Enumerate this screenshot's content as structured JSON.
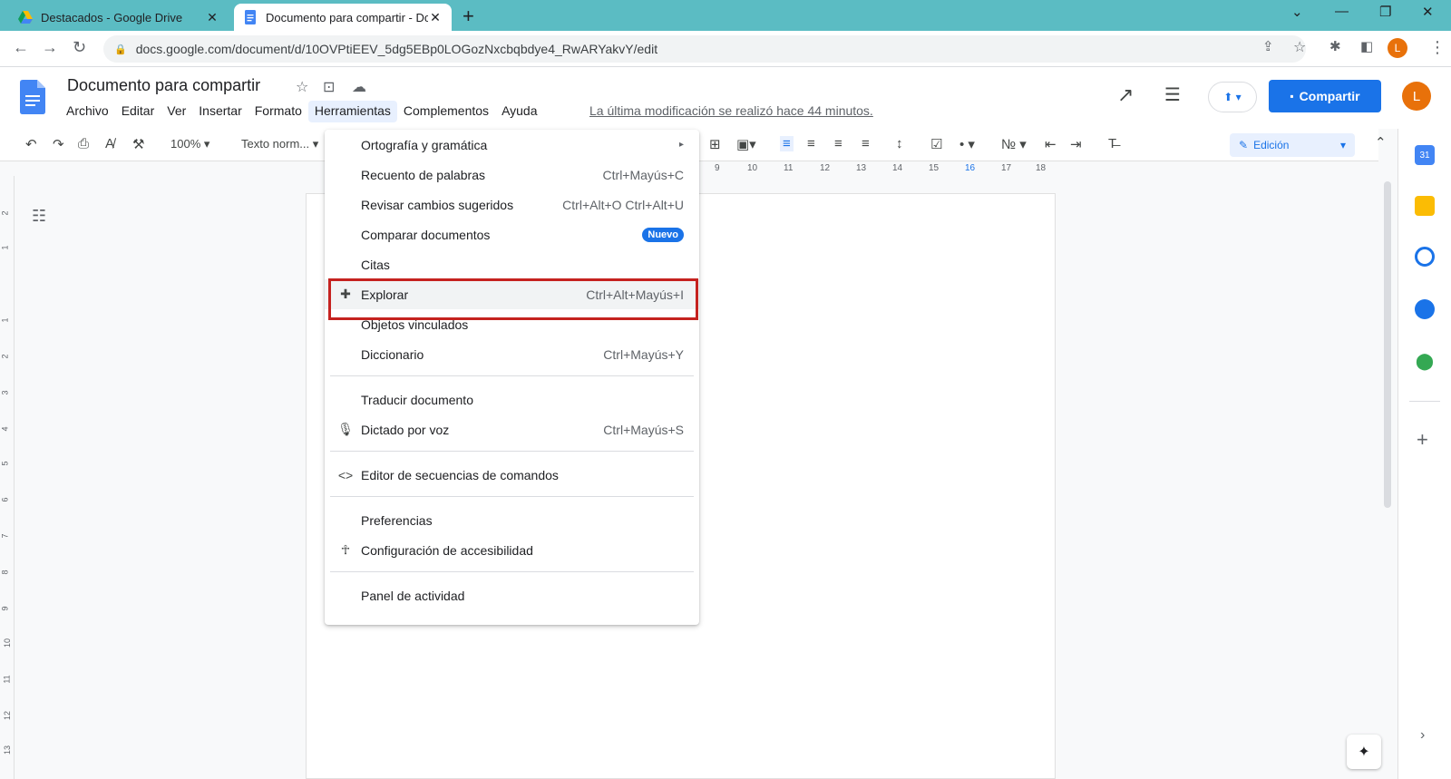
{
  "browser": {
    "tabs": [
      {
        "title": "Destacados - Google Drive"
      },
      {
        "title": "Documento para compartir - Doc"
      }
    ],
    "url": "docs.google.com/document/d/10OVPtiEEV_5dg5EBp0LOGozNxcbqbdye4_RwARYakvY/edit",
    "profile_initial": "L"
  },
  "doc": {
    "title": "Documento para compartir",
    "menus": [
      "Archivo",
      "Editar",
      "Ver",
      "Insertar",
      "Formato",
      "Herramientas",
      "Complementos",
      "Ayuda"
    ],
    "active_menu": "Herramientas",
    "last_edit": "La última modificación se realizó hace 44 minutos.",
    "share_label": "Compartir",
    "avatar_initial": "L"
  },
  "toolbar": {
    "zoom": "100%",
    "style": "Texto norm...",
    "mode": "Edición"
  },
  "ruler": {
    "ticks": [
      "9",
      "10",
      "11",
      "12",
      "13",
      "14",
      "15",
      "16",
      "17",
      "18"
    ]
  },
  "vruler": {
    "ticks": [
      "2",
      "1",
      "1",
      "2",
      "3",
      "4",
      "5",
      "6",
      "7",
      "8",
      "9",
      "10",
      "11",
      "12",
      "13"
    ]
  },
  "tools_menu": {
    "items": [
      {
        "label": "Ortografía y gramática",
        "shortcut": "▸",
        "icon": ""
      },
      {
        "label": "Recuento de palabras",
        "shortcut": "Ctrl+Mayús+C",
        "icon": ""
      },
      {
        "label": "Revisar cambios sugeridos",
        "shortcut": "Ctrl+Alt+O Ctrl+Alt+U",
        "icon": ""
      },
      {
        "label": "Comparar documentos",
        "badge": "Nuevo",
        "icon": ""
      },
      {
        "label": "Citas",
        "shortcut": "",
        "icon": ""
      },
      {
        "label": "Explorar",
        "shortcut": "Ctrl+Alt+Mayús+I",
        "icon": "explore-icon"
      },
      {
        "label": "Objetos vinculados",
        "shortcut": "",
        "icon": ""
      },
      {
        "label": "Diccionario",
        "shortcut": "Ctrl+Mayús+Y",
        "icon": ""
      },
      {
        "label": "Traducir documento",
        "shortcut": "",
        "icon": ""
      },
      {
        "label": "Dictado por voz",
        "shortcut": "Ctrl+Mayús+S",
        "icon": "mic-icon"
      },
      {
        "label": "Editor de secuencias de comandos",
        "shortcut": "",
        "icon": "code-icon"
      },
      {
        "label": "Preferencias",
        "shortcut": "",
        "icon": ""
      },
      {
        "label": "Configuración de accesibilidad",
        "shortcut": "",
        "icon": "accessibility-icon"
      },
      {
        "label": "Panel de actividad",
        "shortcut": "",
        "icon": ""
      }
    ]
  },
  "colors": {
    "tabbar": "#5bbcc3",
    "accent": "#1a73e8",
    "highlight_box": "#c5221f",
    "avatar": "#e8710a"
  }
}
